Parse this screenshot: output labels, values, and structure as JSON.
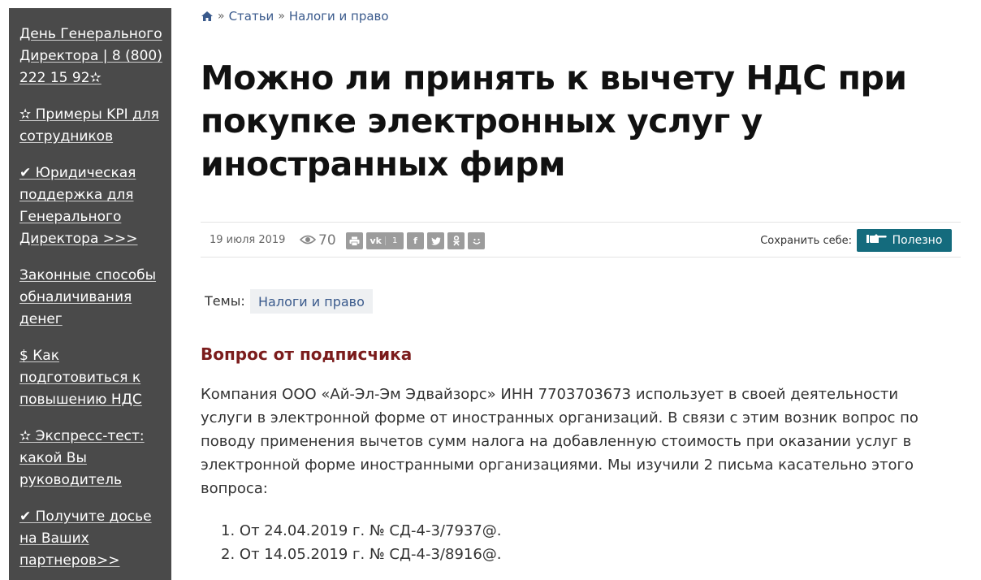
{
  "sidebar": {
    "items": [
      "День Генерального Директора | 8 (800) 222 15 92✫",
      "✫ Примеры KPI для сотрудников",
      "✔ Юридическая поддержка для Генерального Директора >>>",
      "Законные способы обналичивания денег",
      "$ Как подготовиться к повышению НДС",
      "✫ Экспресс-тест: какой Вы руководитель",
      "✔ Получите досье на Ваших партнеров>>"
    ]
  },
  "breadcrumb": {
    "home_icon": "home-icon",
    "separator": "»",
    "items": [
      "Статьи",
      "Налоги и право"
    ]
  },
  "article": {
    "title": "Можно ли принять к вычету НДС при покупке электронных услуг у иностранных фирм",
    "date": "19 июля 2019",
    "views": "70",
    "share": {
      "print_icon": "print-icon",
      "vk_label": "vk",
      "vk_count": "1",
      "facebook_label": "f",
      "twitter_icon": "twitter-icon",
      "ok_icon": "odnoklassniki-icon",
      "mail_icon": "smile-icon"
    },
    "save_label": "Сохранить себе:",
    "useful_button": "Полезно",
    "topics_label": "Темы:",
    "topic": "Налоги и право",
    "section_heading": "Вопрос от подписчика",
    "body": "Компания ООО «Ай-Эл-Эм Эдвайзорс» ИНН 7703703673 использует в своей деятельности услуги в электронной форме от иностранных организаций. В связи с этим возник вопрос по поводу применения вычетов сумм налога на добавленную стоимость при оказании услуг в электронной форме иностранными организациями. Мы изучили 2 письма касательно этого вопроса:",
    "letters": [
      "1. От 24.04.2019 г. № СД-4-3/7937@.",
      "2. От 14.05.2019 г. № СД-4-3/8916@."
    ]
  },
  "colors": {
    "sidebar_bg": "#4a4a4a",
    "link": "#3a5a8c",
    "heading_red": "#7b1c1c",
    "useful_button": "#146b7d"
  }
}
